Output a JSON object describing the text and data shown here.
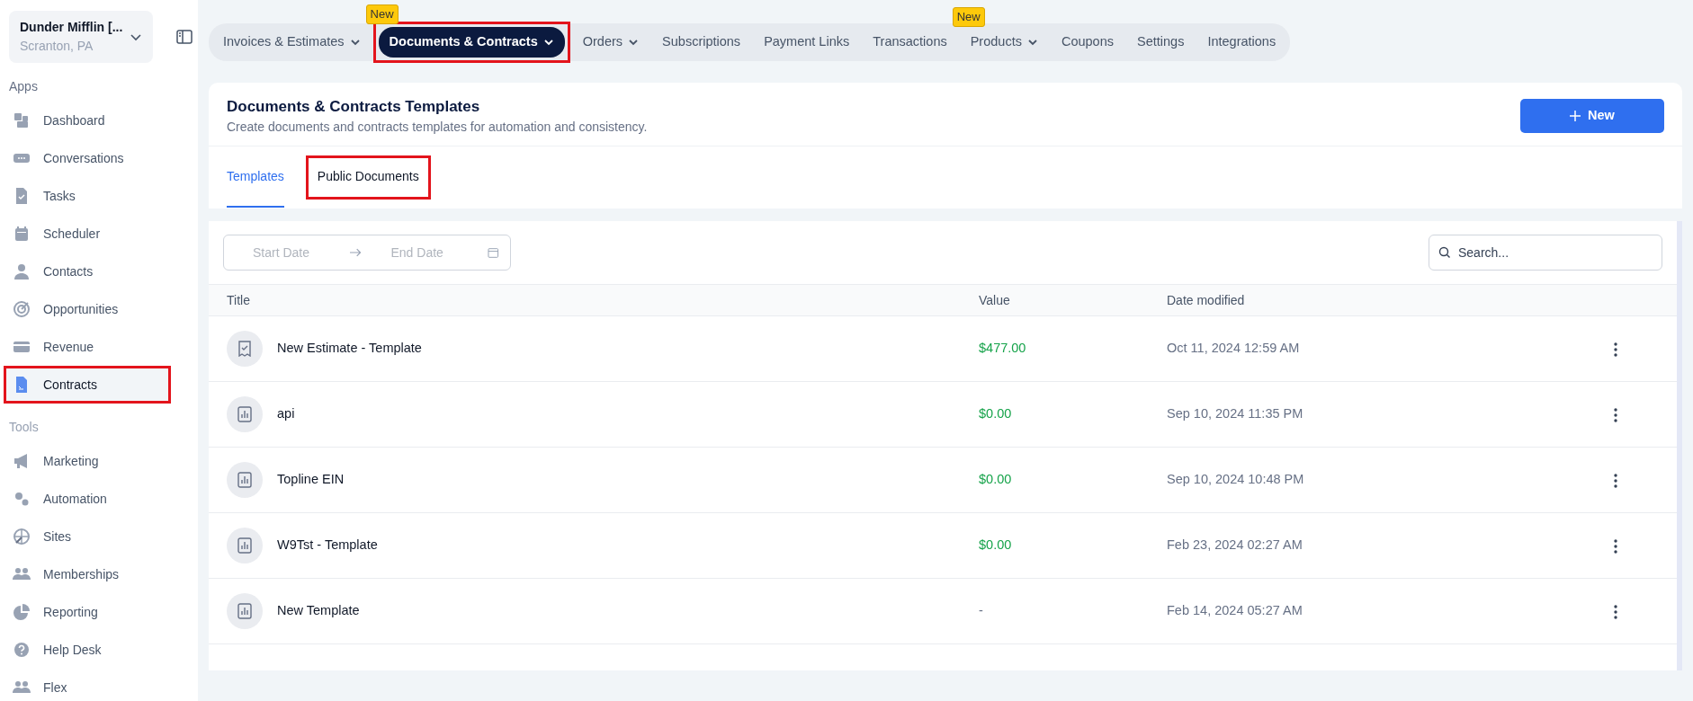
{
  "account": {
    "name": "Dunder Mifflin [...",
    "location": "Scranton, PA"
  },
  "sidebar": {
    "sections": [
      {
        "title": "Apps",
        "items": [
          {
            "label": "Dashboard",
            "selected": false,
            "highlighted": false
          },
          {
            "label": "Conversations",
            "selected": false,
            "highlighted": false
          },
          {
            "label": "Tasks",
            "selected": false,
            "highlighted": false
          },
          {
            "label": "Scheduler",
            "selected": false,
            "highlighted": false
          },
          {
            "label": "Contacts",
            "selected": false,
            "highlighted": false
          },
          {
            "label": "Opportunities",
            "selected": false,
            "highlighted": false
          },
          {
            "label": "Revenue",
            "selected": false,
            "highlighted": false
          },
          {
            "label": "Contracts",
            "selected": true,
            "highlighted": true
          }
        ]
      },
      {
        "title": "Tools",
        "items": [
          {
            "label": "Marketing",
            "selected": false,
            "highlighted": false
          },
          {
            "label": "Automation",
            "selected": false,
            "highlighted": false
          },
          {
            "label": "Sites",
            "selected": false,
            "highlighted": false
          },
          {
            "label": "Memberships",
            "selected": false,
            "highlighted": false
          },
          {
            "label": "Reporting",
            "selected": false,
            "highlighted": false
          },
          {
            "label": "Help Desk",
            "selected": false,
            "highlighted": false
          },
          {
            "label": "Flex",
            "selected": false,
            "highlighted": false
          }
        ]
      }
    ]
  },
  "top_nav": [
    {
      "label": "Invoices & Estimates",
      "dropdown": true,
      "selected": false,
      "highlighted": false
    },
    {
      "label": "Documents & Contracts",
      "dropdown": true,
      "badge": "New",
      "selected": true,
      "highlighted": true
    },
    {
      "label": "Orders",
      "dropdown": true,
      "selected": false,
      "highlighted": false
    },
    {
      "label": "Subscriptions",
      "dropdown": false,
      "selected": false,
      "highlighted": false
    },
    {
      "label": "Payment Links",
      "dropdown": false,
      "selected": false,
      "highlighted": false
    },
    {
      "label": "Transactions",
      "dropdown": false,
      "selected": false,
      "highlighted": false
    },
    {
      "label": "Products",
      "dropdown": true,
      "badge": "New",
      "selected": false,
      "highlighted": false
    },
    {
      "label": "Coupons",
      "dropdown": false,
      "selected": false,
      "highlighted": false
    },
    {
      "label": "Settings",
      "dropdown": false,
      "selected": false,
      "highlighted": false
    },
    {
      "label": "Integrations",
      "dropdown": false,
      "selected": false,
      "highlighted": false
    }
  ],
  "header": {
    "title": "Documents & Contracts Templates",
    "subtitle": "Create documents and contracts templates for automation and consistency.",
    "new_button": "New"
  },
  "tabs": [
    {
      "label": "Templates",
      "selected": true,
      "highlighted": false
    },
    {
      "label": "Public Documents",
      "selected": false,
      "highlighted": true
    }
  ],
  "filters": {
    "start_placeholder": "Start Date",
    "end_placeholder": "End Date",
    "search_placeholder": "Search..."
  },
  "table": {
    "columns": [
      "Title",
      "Value",
      "Date modified"
    ],
    "rows": [
      {
        "kind": "estimate",
        "title": "New Estimate - Template",
        "value": "$477.00",
        "date": "Oct 11, 2024 12:59 AM"
      },
      {
        "kind": "document",
        "title": "api",
        "value": "$0.00",
        "date": "Sep 10, 2024 11:35 PM"
      },
      {
        "kind": "document",
        "title": "Topline EIN",
        "value": "$0.00",
        "date": "Sep 10, 2024 10:48 PM"
      },
      {
        "kind": "document",
        "title": "W9Tst - Template",
        "value": "$0.00",
        "date": "Feb 23, 2024 02:27 AM"
      },
      {
        "kind": "document",
        "title": "New Template",
        "value": "-",
        "date": "Feb 14, 2024 05:27 AM"
      }
    ]
  }
}
